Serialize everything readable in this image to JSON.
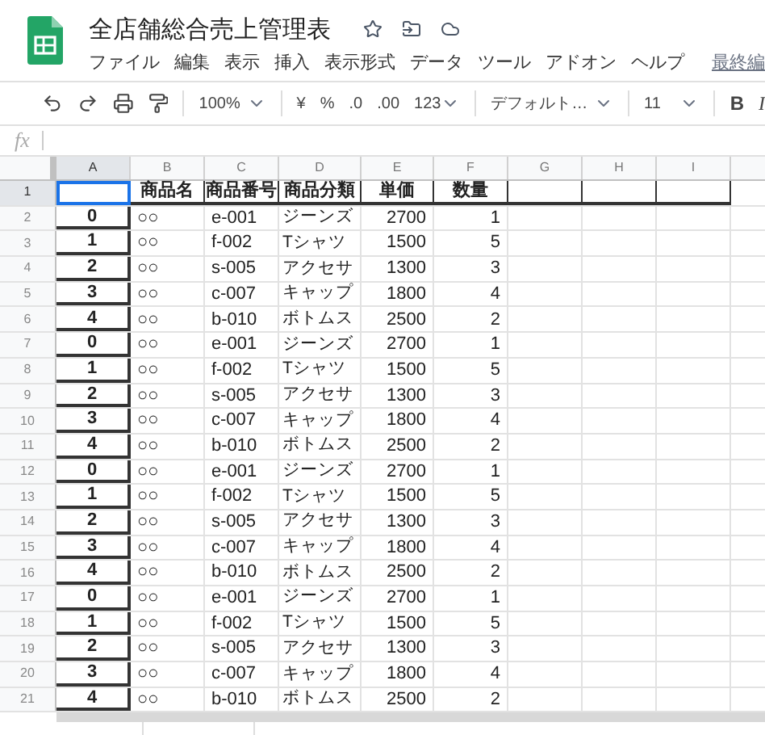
{
  "app": {
    "title": "全店舗総合売上管理表",
    "menu": [
      "ファイル",
      "編集",
      "表示",
      "挿入",
      "表示形式",
      "データ",
      "ツール",
      "アドオン",
      "ヘルプ"
    ],
    "last_edit": "最終編"
  },
  "toolbar": {
    "zoom": "100%",
    "currency": "¥",
    "percent": "%",
    "decrease_decimals": ".0",
    "increase_decimals": ".00",
    "number_format": "123",
    "font": "デフォルト…",
    "font_size": "11",
    "bold": "B",
    "italic": "I"
  },
  "formula_bar": {
    "label": "fx"
  },
  "sheet": {
    "columns": [
      {
        "label": "A",
        "selected": true
      },
      {
        "label": "B",
        "selected": false
      },
      {
        "label": "C",
        "selected": false
      },
      {
        "label": "D",
        "selected": false
      },
      {
        "label": "E",
        "selected": false
      },
      {
        "label": "F",
        "selected": false
      },
      {
        "label": "G",
        "selected": false
      },
      {
        "label": "H",
        "selected": false
      },
      {
        "label": "I",
        "selected": false
      }
    ],
    "rows": [
      {
        "number": "1",
        "selected": true,
        "cells": [
          "",
          "商品名",
          "商品番号",
          "商品分類",
          "単価",
          "数量"
        ]
      },
      {
        "number": "2",
        "selected": false,
        "cells": [
          "0",
          "○○",
          "e-001",
          "ジーンズ",
          "2700",
          "1"
        ]
      },
      {
        "number": "3",
        "selected": false,
        "cells": [
          "1",
          "○○",
          "f-002",
          "Tシャツ",
          "1500",
          "5"
        ]
      },
      {
        "number": "4",
        "selected": false,
        "cells": [
          "2",
          "○○",
          "s-005",
          "アクセサ",
          "1300",
          "3"
        ]
      },
      {
        "number": "5",
        "selected": false,
        "cells": [
          "3",
          "○○",
          "c-007",
          "キャップ",
          "1800",
          "4"
        ]
      },
      {
        "number": "6",
        "selected": false,
        "cells": [
          "4",
          "○○",
          "b-010",
          "ボトムス",
          "2500",
          "2"
        ]
      },
      {
        "number": "7",
        "selected": false,
        "cells": [
          "0",
          "○○",
          "e-001",
          "ジーンズ",
          "2700",
          "1"
        ]
      },
      {
        "number": "8",
        "selected": false,
        "cells": [
          "1",
          "○○",
          "f-002",
          "Tシャツ",
          "1500",
          "5"
        ]
      },
      {
        "number": "9",
        "selected": false,
        "cells": [
          "2",
          "○○",
          "s-005",
          "アクセサ",
          "1300",
          "3"
        ]
      },
      {
        "number": "10",
        "selected": false,
        "cells": [
          "3",
          "○○",
          "c-007",
          "キャップ",
          "1800",
          "4"
        ]
      },
      {
        "number": "11",
        "selected": false,
        "cells": [
          "4",
          "○○",
          "b-010",
          "ボトムス",
          "2500",
          "2"
        ]
      },
      {
        "number": "12",
        "selected": false,
        "cells": [
          "0",
          "○○",
          "e-001",
          "ジーンズ",
          "2700",
          "1"
        ]
      },
      {
        "number": "13",
        "selected": false,
        "cells": [
          "1",
          "○○",
          "f-002",
          "Tシャツ",
          "1500",
          "5"
        ]
      },
      {
        "number": "14",
        "selected": false,
        "cells": [
          "2",
          "○○",
          "s-005",
          "アクセサ",
          "1300",
          "3"
        ]
      },
      {
        "number": "15",
        "selected": false,
        "cells": [
          "3",
          "○○",
          "c-007",
          "キャップ",
          "1800",
          "4"
        ]
      },
      {
        "number": "16",
        "selected": false,
        "cells": [
          "4",
          "○○",
          "b-010",
          "ボトムス",
          "2500",
          "2"
        ]
      },
      {
        "number": "17",
        "selected": false,
        "cells": [
          "0",
          "○○",
          "e-001",
          "ジーンズ",
          "2700",
          "1"
        ]
      },
      {
        "number": "18",
        "selected": false,
        "cells": [
          "1",
          "○○",
          "f-002",
          "Tシャツ",
          "1500",
          "5"
        ]
      },
      {
        "number": "19",
        "selected": false,
        "cells": [
          "2",
          "○○",
          "s-005",
          "アクセサ",
          "1300",
          "3"
        ]
      },
      {
        "number": "20",
        "selected": false,
        "cells": [
          "3",
          "○○",
          "c-007",
          "キャップ",
          "1800",
          "4"
        ]
      },
      {
        "number": "21",
        "selected": false,
        "cells": [
          "4",
          "○○",
          "b-010",
          "ボトムス",
          "2500",
          "2"
        ]
      }
    ]
  }
}
